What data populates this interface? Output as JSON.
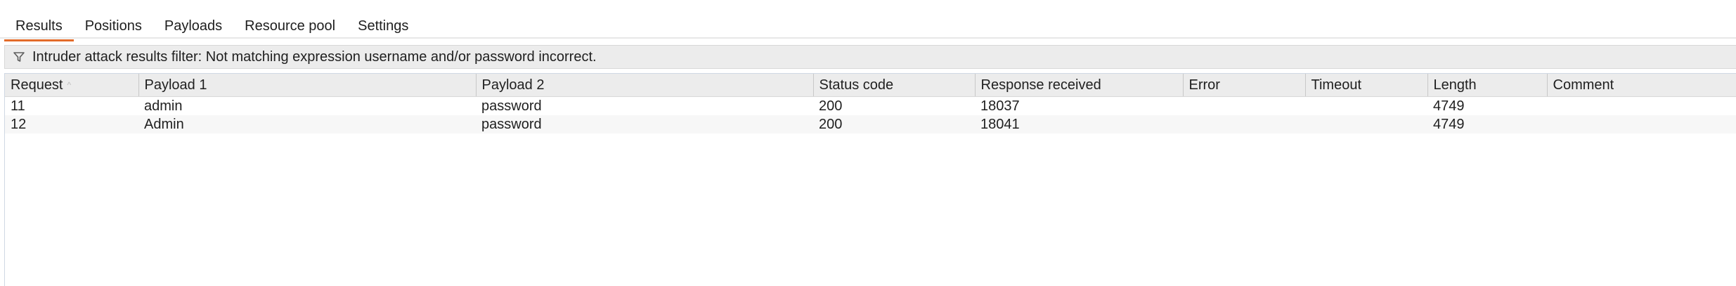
{
  "tabs": [
    {
      "label": "Results",
      "active": true
    },
    {
      "label": "Positions",
      "active": false
    },
    {
      "label": "Payloads",
      "active": false
    },
    {
      "label": "Resource pool",
      "active": false
    },
    {
      "label": "Settings",
      "active": false
    }
  ],
  "filter": {
    "text": "Intruder attack results filter: Not matching expression username and/or password incorrect.",
    "icon": "filter-icon"
  },
  "table": {
    "columns": [
      "Request",
      "Payload 1",
      "Payload 2",
      "Status code",
      "Response received",
      "Error",
      "Timeout",
      "Length",
      "Comment"
    ],
    "sort_indicator": "ascending",
    "rows": [
      [
        "11",
        "admin",
        "password",
        "200",
        "18037",
        "",
        "",
        "4749",
        ""
      ],
      [
        "12",
        "Admin",
        "password",
        "200",
        "18041",
        "",
        "",
        "4749",
        ""
      ]
    ]
  },
  "colors": {
    "active_tab_underline": "#e36b2a",
    "header_background": "#ececec",
    "filter_background": "#ececec"
  }
}
